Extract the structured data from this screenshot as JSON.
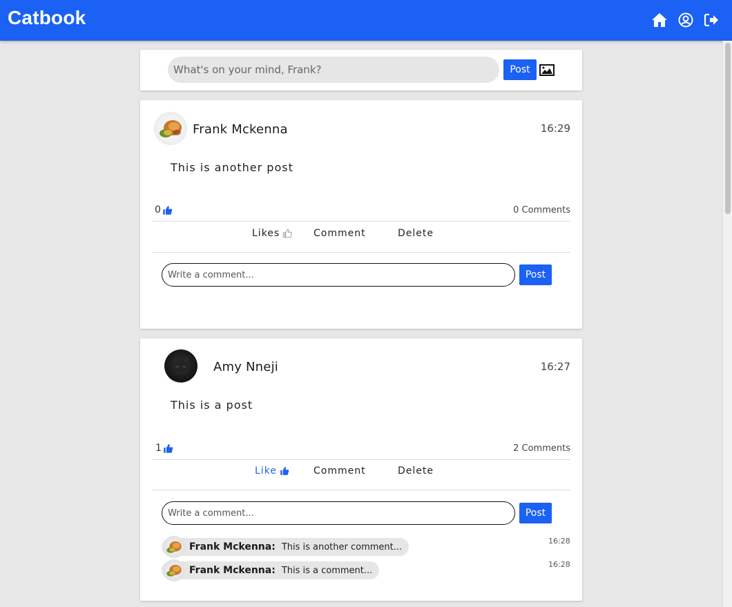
{
  "header": {
    "brand": "Catbook"
  },
  "composer": {
    "placeholder": "What's on your mind, Frank?",
    "post_label": "Post"
  },
  "posts": [
    {
      "author": "Frank Mckenna",
      "time": "16:29",
      "text": "This is another post",
      "likes": "0",
      "comments_count": "0 Comments",
      "actions": {
        "like": "Likes",
        "comment": "Comment",
        "delete": "Delete"
      },
      "comment_placeholder": "Write a comment...",
      "comment_post_label": "Post",
      "comments": []
    },
    {
      "author": "Amy Nneji",
      "time": "16:27",
      "text": "This is a post",
      "likes": "1",
      "comments_count": "2 Comments",
      "actions": {
        "like": "Like",
        "comment": "Comment",
        "delete": "Delete"
      },
      "comment_placeholder": "Write a comment...",
      "comment_post_label": "Post",
      "comments": [
        {
          "author": "Frank Mckenna:",
          "text": "This is another comment...",
          "time": "16:28"
        },
        {
          "author": "Frank Mckenna:",
          "text": "This is a comment...",
          "time": "16:28"
        }
      ]
    }
  ],
  "colors": {
    "accent": "#1a61f4",
    "background": "#e7e7e7",
    "card": "#ffffff"
  }
}
